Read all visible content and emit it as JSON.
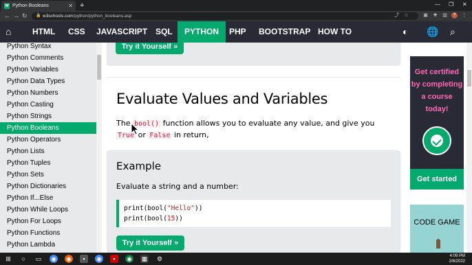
{
  "browser": {
    "tab_title": "Python Booleans",
    "favicon": "W",
    "url_host": "w3schools.com",
    "url_path": "/python/python_booleans.asp",
    "avatar": "?"
  },
  "nav": {
    "items": [
      "HTML",
      "CSS",
      "JAVASCRIPT",
      "SQL",
      "PYTHON",
      "PHP",
      "BOOTSTRAP",
      "HOW TO"
    ],
    "active": "PYTHON",
    "icons": [
      "home-icon",
      "contrast-icon",
      "globe-icon",
      "search-icon"
    ]
  },
  "sidebar": {
    "items": [
      "Python Syntax",
      "Python Comments",
      "Python Variables",
      "Python Data Types",
      "Python Numbers",
      "Python Casting",
      "Python Strings",
      "Python Booleans",
      "Python Operators",
      "Python Lists",
      "Python Tuples",
      "Python Sets",
      "Python Dictionaries",
      "Python If...Else",
      "Python While Loops",
      "Python For Loops",
      "Python Functions",
      "Python Lambda"
    ],
    "active_index": 7
  },
  "main": {
    "try_button_top": "Try it Yourself »",
    "heading": "Evaluate Values and Variables",
    "para_pre": "The",
    "para_code1": "bool()",
    "para_mid": "function allows you to evaluate any value, and give you",
    "para_code2": "True",
    "para_or": "or",
    "para_code3": "False",
    "para_post": "in return,",
    "example": {
      "title": "Example",
      "desc": "Evaluate a string and a number:",
      "line1_a": "print(bool(",
      "line1_str": "\"Hello\"",
      "line1_b": "))",
      "line2_a": "print(bool(",
      "line2_num": "15",
      "line2_b": "))"
    },
    "try_button_bottom": "Try it Yourself »"
  },
  "ad": {
    "lines": [
      "Get certified",
      "by completing",
      "a course",
      "today!"
    ],
    "cta": "Get started"
  },
  "ad2": {
    "title": "CODE GAME"
  },
  "taskbar": {
    "time": "4:09 PM",
    "date": "2/8/2022"
  },
  "colors": {
    "brand_green": "#04aa6d",
    "nav_bg": "#282a35",
    "ad_text_pink": "#ff69b4"
  }
}
